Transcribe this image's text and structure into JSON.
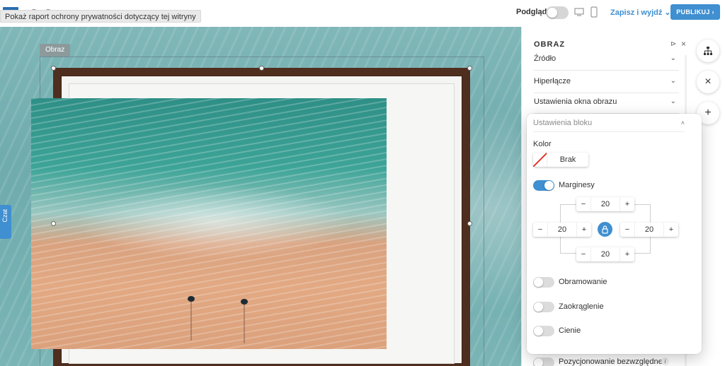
{
  "tooltip": "Pokaż raport ochrony prywatności dotyczący tej witryny",
  "topbar": {
    "preview_label": "Podgląd",
    "save_exit_label": "Zapisz i wyjdź",
    "publish_label": "PUBLIKUJ"
  },
  "canvas": {
    "block_tag": "Obraz",
    "chat_label": "Czat"
  },
  "panel": {
    "title": "OBRAZ",
    "sections": [
      "Źródło",
      "Hiperłącze",
      "Ustawienia okna obrazu",
      "Ustawienia bloku"
    ],
    "kolor_label": "Kolor",
    "kolor_value": "Brak",
    "margins_label": "Marginesy",
    "margins_enabled": true,
    "margins": {
      "top": "20",
      "left": "20",
      "right": "20",
      "bottom": "20"
    },
    "toggles": [
      {
        "label": "Obramowanie",
        "enabled": false
      },
      {
        "label": "Zaokrąglenie",
        "enabled": false
      },
      {
        "label": "Cienie",
        "enabled": false
      }
    ],
    "absolute_label": "Pozycjonowanie bezwzględne",
    "absolute_enabled": false,
    "info_glyph": "i"
  },
  "glyphs": {
    "chevron_down": "⌄",
    "chevron_up": "˄",
    "close": "×",
    "pin": "📌",
    "minus": "−",
    "plus": "+"
  },
  "colors": {
    "accent": "#3f8fd1",
    "frame": "#4f2e1f",
    "sea": "#74b3b5"
  },
  "icons": [
    "sitemap-icon",
    "close-icon",
    "plus-icon",
    "lock-icon",
    "desktop-icon",
    "mobile-icon",
    "pin-icon",
    "info-icon"
  ]
}
